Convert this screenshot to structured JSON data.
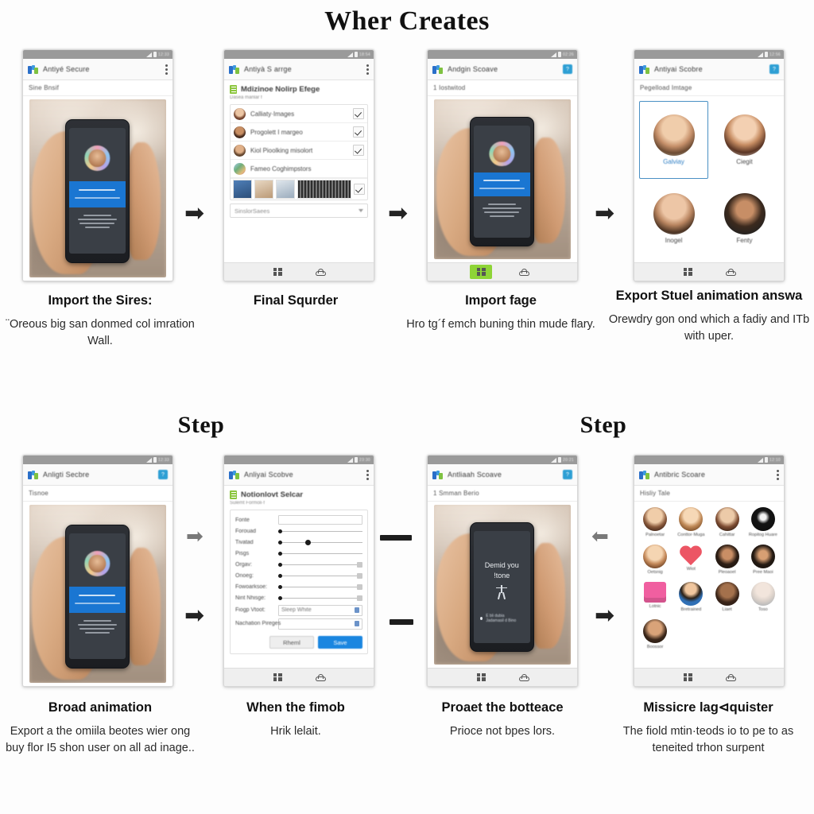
{
  "headings": {
    "main": "Wher Creates",
    "step_left": "Step",
    "step_right": "Step"
  },
  "captions": [
    {
      "title": "Import the Sires:",
      "body": "¨Oreous big san donmed col imration Wall."
    },
    {
      "title": "Final Squrder",
      "body": ""
    },
    {
      "title": "Import fage",
      "body": "Hro tg´f emch buning thin mude flary."
    },
    {
      "title": "Export Stuel animation answa",
      "body": "Orewdry gon ond which a fadiy and ITb with uper."
    },
    {
      "title": "Broad animation",
      "body": "Export a the omiila beotes wier ong buy flor I5 shon user on all ad inage.."
    },
    {
      "title": "When the fimob",
      "body": "Hrik lelait."
    },
    {
      "title": "Proaet the botteace",
      "body": "Prioce not bpes lors."
    },
    {
      "title": "Missicre lag⊲quister",
      "body": "The fiold mtin·teods io to pe to as teneited trhon surpent"
    }
  ],
  "panels": [
    {
      "id": "panel-1",
      "app_title": "Antiyé Secure",
      "status_time": "12:33",
      "menu_icon": "kebab-menu-icon",
      "subtitle": "Sine Bnsif",
      "content": "photo-hand-phone"
    },
    {
      "id": "panel-2",
      "app_title": "Antiyà S arrge",
      "status_time": "18:54",
      "menu_icon": "kebab-menu-icon",
      "sheet_title": "Mdizinoe Nolirp Efege",
      "sheet_sub": "Dasea manlār f",
      "list": [
        {
          "label": "Calliaty·Images",
          "checked": true
        },
        {
          "label": "Progolett I margeo",
          "checked": true
        },
        {
          "label": "Kiol Pioolking misolort",
          "checked": true
        },
        {
          "label": "Fameo Coghimpstors",
          "checked": false
        }
      ],
      "thumb_row_label": "thumbnail-strip",
      "search_value": "SinslorSaees"
    },
    {
      "id": "panel-3",
      "app_title": "Andgin Scoave",
      "status_time": "02:26",
      "menu_icon": "blue-badge-icon",
      "subtitle": "1 Iostwitod",
      "content": "photo-hand-phone",
      "bottom_nav_active": "grid"
    },
    {
      "id": "panel-4",
      "app_title": "Antiyai Scobre",
      "status_time": "12:56",
      "menu_icon": "blue-badge-icon",
      "subtitle": "Pegelload Imtage",
      "grid": [
        {
          "label": "Galviay",
          "selected": true
        },
        {
          "label": "Ciegit",
          "selected": false
        },
        {
          "label": "Inogel",
          "selected": false
        },
        {
          "label": "Fenty",
          "selected": false
        }
      ]
    },
    {
      "id": "panel-5",
      "app_title": "Anligti Secbre",
      "status_time": "12:33",
      "menu_icon": "blue-badge-icon",
      "subtitle": "Tisnoe",
      "content": "photo-hand-phone"
    },
    {
      "id": "panel-6",
      "app_title": "Anliyai Scobve",
      "status_time": "23:30",
      "menu_icon": "kebab-menu-icon",
      "sheet_title": "Notionlovt Selcar",
      "sheet_sub": "Sulemt Formoli·f",
      "fields": [
        {
          "label": "Fonte",
          "type": "input"
        },
        {
          "label": "Forouad",
          "type": "slider",
          "knob": 0
        },
        {
          "label": "Tivatad",
          "type": "slider",
          "knob": 32
        },
        {
          "label": "Pisgs",
          "type": "slider",
          "knob": 0
        },
        {
          "label": "Orgav:",
          "type": "slider-box",
          "knob": 0
        },
        {
          "label": "Onoeg:",
          "type": "slider-box",
          "knob": 0
        },
        {
          "label": "Fowoarksoe:",
          "type": "slider-box",
          "knob": 0
        },
        {
          "label": "Nint Nhisge:",
          "type": "slider-box",
          "knob": 0
        }
      ],
      "select_label": "Fiogp Vtoot:",
      "select_value": "Sleep White",
      "last_label": "Nachation Pireges",
      "buttons": {
        "secondary": "Rheml",
        "primary": "Save"
      }
    },
    {
      "id": "panel-7",
      "app_title": "Antliaah Scoave",
      "status_time": "20:21",
      "menu_icon": "blue-badge-icon",
      "subtitle": "1 Smman Berio",
      "content": "photo-hand-phone-dark",
      "device_text_line1": "Demid you",
      "device_text_line2": "!tone",
      "device_note": "E bli dubia Jadamasil d Bino"
    },
    {
      "id": "panel-8",
      "app_title": "Antibric Scoare",
      "status_time": "12:10",
      "menu_icon": "kebab-menu-icon",
      "subtitle": "Hisliy Tale",
      "grid": [
        {
          "label": "Palnoetar",
          "kind": "face-a"
        },
        {
          "label": "Conttor·Muga",
          "kind": "face-b"
        },
        {
          "label": "Cahittar",
          "kind": "face-c"
        },
        {
          "label": "Ropitog Huare",
          "kind": "face-dark"
        },
        {
          "label": "Oetsnig",
          "kind": "face-d"
        },
        {
          "label": "Wiot",
          "kind": "heart"
        },
        {
          "label": "Pleoaoel",
          "kind": "face-e"
        },
        {
          "label": "Pree Maoi",
          "kind": "face-f"
        },
        {
          "label": "Lotnic",
          "kind": "pinkbox"
        },
        {
          "label": "Bretrained",
          "kind": "face-avatar"
        },
        {
          "label": "Liaet",
          "kind": "face-g"
        },
        {
          "label": "Toso",
          "kind": "face-h"
        },
        {
          "label": "Boossor",
          "kind": "face-i"
        }
      ]
    }
  ],
  "arrows": {
    "row1": [
      "arrow-right",
      "arrow-right",
      "arrow-right"
    ],
    "row2_top": [
      "arrow-right-faded",
      "divider-bar",
      "arrow-left-faded"
    ],
    "row2_bottom": [
      "arrow-right",
      "divider-bar",
      "arrow-right"
    ]
  },
  "colors": {
    "accent_blue": "#1a86e0",
    "band_blue": "#1a76d2",
    "nav_active_green": "#8ed437",
    "selection_border": "#4a90c4"
  }
}
